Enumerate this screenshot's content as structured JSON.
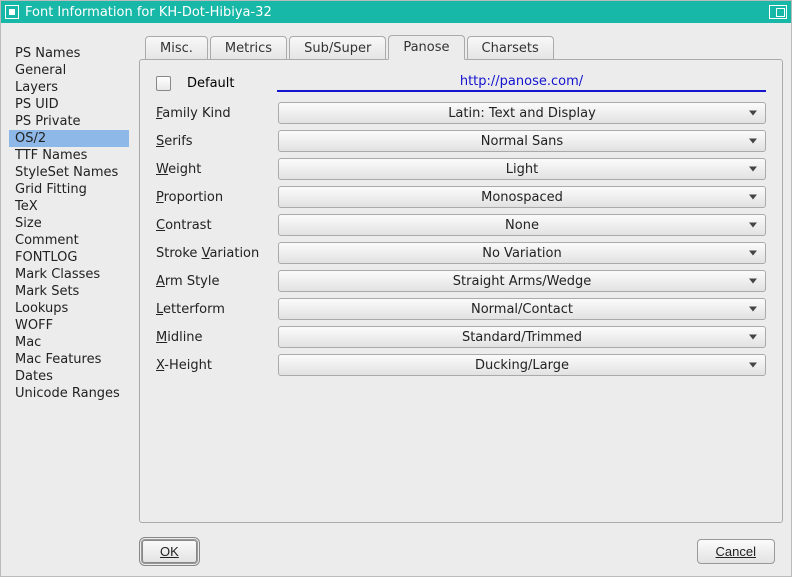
{
  "window": {
    "title": "Font Information for KH-Dot-Hibiya-32"
  },
  "sidebar": {
    "items": [
      "PS Names",
      "General",
      "Layers",
      "PS UID",
      "PS Private",
      "OS/2",
      "TTF Names",
      "StyleSet Names",
      "Grid Fitting",
      "TeX",
      "Size",
      "Comment",
      "FONTLOG",
      "Mark Classes",
      "Mark Sets",
      "Lookups",
      "WOFF",
      "Mac",
      "Mac Features",
      "Dates",
      "Unicode Ranges"
    ],
    "selected": "OS/2"
  },
  "tabs": {
    "items": [
      "Misc.",
      "Metrics",
      "Sub/Super",
      "Panose",
      "Charsets"
    ],
    "active": "Panose"
  },
  "panose": {
    "default_label": "Default",
    "link": "http://panose.com/",
    "fields": [
      {
        "key": "family_kind",
        "label_pre": "",
        "label_u": "F",
        "label_post": "amily Kind",
        "value": "Latin: Text and Display"
      },
      {
        "key": "serifs",
        "label_pre": "",
        "label_u": "S",
        "label_post": "erifs",
        "value": "Normal Sans"
      },
      {
        "key": "weight",
        "label_pre": "",
        "label_u": "W",
        "label_post": "eight",
        "value": "Light"
      },
      {
        "key": "proportion",
        "label_pre": "",
        "label_u": "P",
        "label_post": "roportion",
        "value": "Monospaced"
      },
      {
        "key": "contrast",
        "label_pre": "",
        "label_u": "C",
        "label_post": "ontrast",
        "value": "None"
      },
      {
        "key": "stroke_variation",
        "label_pre": "Stroke ",
        "label_u": "V",
        "label_post": "ariation",
        "value": "No Variation"
      },
      {
        "key": "arm_style",
        "label_pre": "",
        "label_u": "A",
        "label_post": "rm Style",
        "value": "Straight Arms/Wedge"
      },
      {
        "key": "letterform",
        "label_pre": "",
        "label_u": "L",
        "label_post": "etterform",
        "value": "Normal/Contact"
      },
      {
        "key": "midline",
        "label_pre": "",
        "label_u": "M",
        "label_post": "idline",
        "value": "Standard/Trimmed"
      },
      {
        "key": "x_height",
        "label_pre": "",
        "label_u": "X",
        "label_post": "-Height",
        "value": "Ducking/Large"
      }
    ]
  },
  "buttons": {
    "ok": "OK",
    "cancel": "Cancel"
  }
}
